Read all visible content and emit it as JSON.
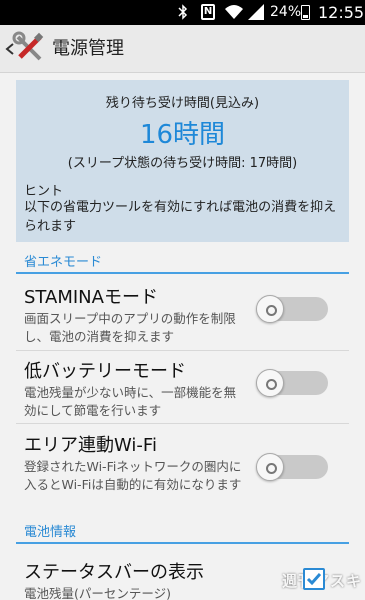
{
  "status_bar": {
    "nfc": "N",
    "battery_percent": "24%",
    "battery_level": 0.24,
    "time": "12:55",
    "icons": [
      "bluetooth-icon",
      "nfc-icon",
      "wifi-icon",
      "signal-icon",
      "battery-icon"
    ]
  },
  "action_bar": {
    "title": "電源管理",
    "back_icon": "chevron-left-icon",
    "app_icon": "tools-icon"
  },
  "standby": {
    "label": "残り待ち受け時間(見込み)",
    "value": "16時間",
    "sleep_note": "(スリープ状態の待ち受け時間: 17時間)",
    "hint_title": "ヒント",
    "hint_text": "以下の省電力ツールを有効にすれば電池の消費を抑えられます",
    "accent_color": "#1e88d8"
  },
  "sections": {
    "eco": {
      "header": "省エネモード",
      "items": [
        {
          "title": "STAMINAモード",
          "desc": "画面スリープ中のアプリの動作を制限し、電池の消費を抑えます",
          "enabled": false
        },
        {
          "title": "低バッテリーモード",
          "desc": "電池残量が少ない時に、一部機能を無効にして節電を行います",
          "enabled": false
        },
        {
          "title": "エリア連動Wi-Fi",
          "desc": "登録されたWi-Fiネットワークの圏内に入るとWi-Fiは自動的に有効になります",
          "enabled": false
        }
      ]
    },
    "battery": {
      "header": "電池情報",
      "items": [
        {
          "title": "ステータスバーの表示",
          "desc": "電池残量(パーセンテージ)",
          "checked": true
        }
      ]
    }
  },
  "watermark": "週刊アスキー",
  "colors": {
    "section_header": "#2a8ad4",
    "card_background": "#cfdde9",
    "toggle_off": "#c9c9c9"
  }
}
